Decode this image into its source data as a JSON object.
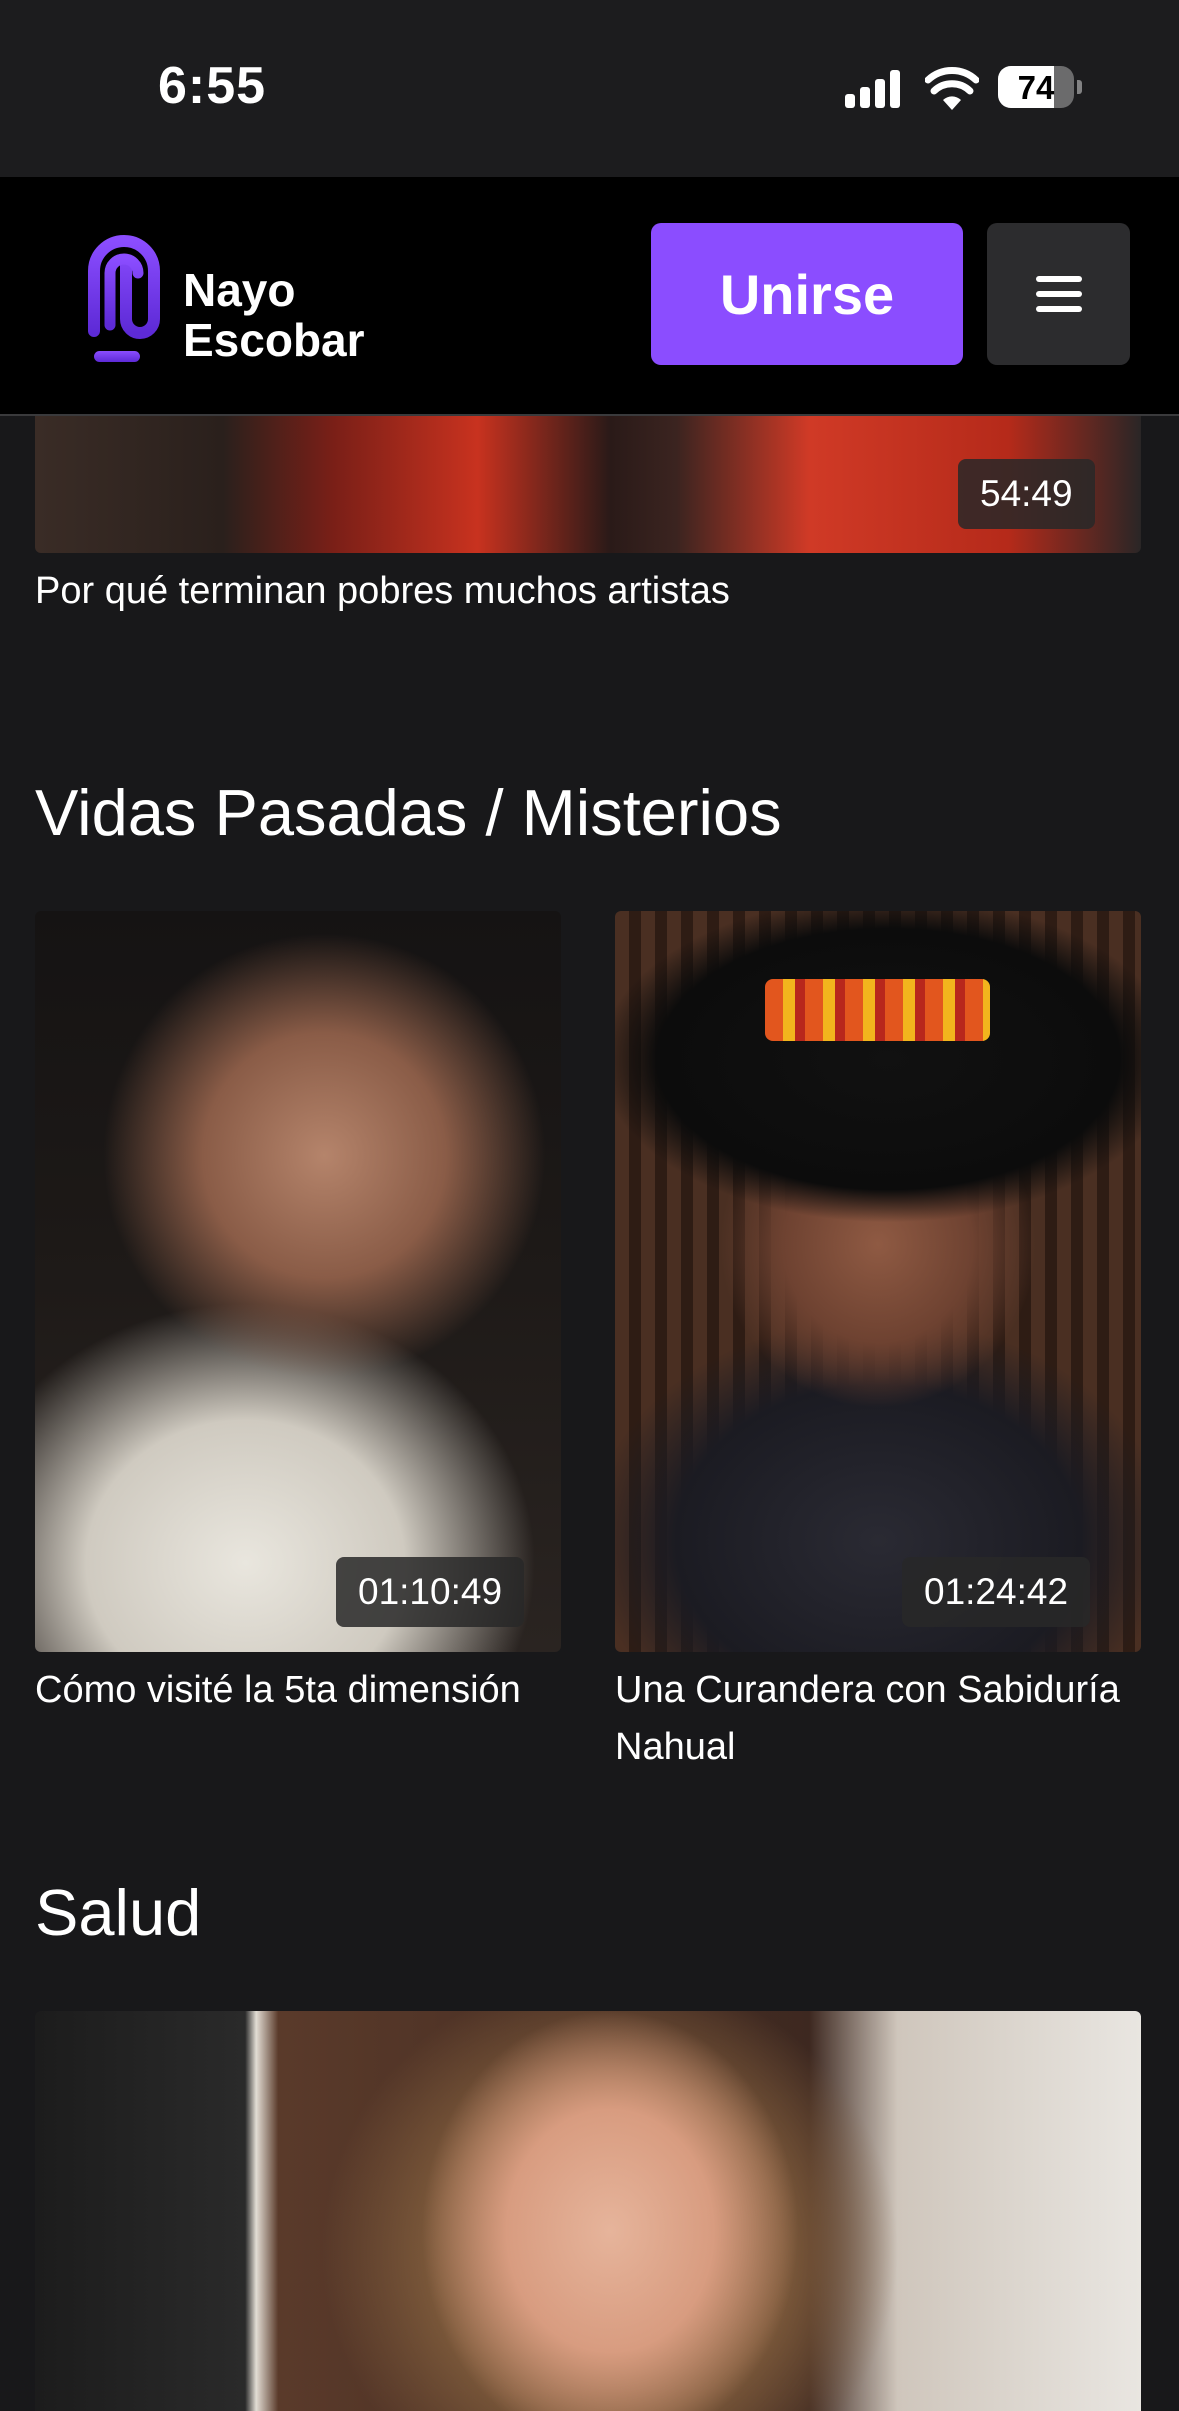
{
  "status_bar": {
    "time": "6:55",
    "battery": "74",
    "battery_level": 0.74
  },
  "header": {
    "logo_line1": "Nayo",
    "logo_line2": "Escobar",
    "join_label": "Unirse",
    "accent_color": "#8b4dff"
  },
  "top_video": {
    "duration": "54:49",
    "title": "Por qué terminan pobres muchos artistas"
  },
  "sections": [
    {
      "title": "Vidas Pasadas / Misterios",
      "videos": [
        {
          "duration": "01:10:49",
          "title": "Cómo visité la 5ta dimensión"
        },
        {
          "duration": "01:24:42",
          "title": "Una Curandera con Sabiduría Nahual"
        }
      ]
    },
    {
      "title": "Salud"
    }
  ]
}
